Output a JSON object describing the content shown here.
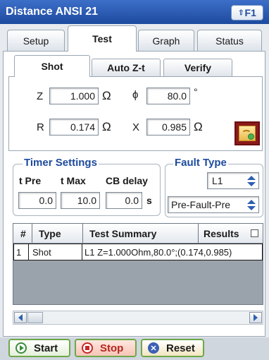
{
  "window": {
    "title": "Distance ANSI 21",
    "help_label": "F1"
  },
  "tabs": [
    {
      "label": "Setup"
    },
    {
      "label": "Test"
    },
    {
      "label": "Graph"
    },
    {
      "label": "Status"
    }
  ],
  "subtabs": [
    {
      "label": "Shot"
    },
    {
      "label": "Auto Z-t"
    },
    {
      "label": "Verify"
    }
  ],
  "shot": {
    "z_label": "Z",
    "z_value": "1.000",
    "z_unit": "Ω",
    "phi_label": "ϕ",
    "phi_value": "80.0",
    "phi_unit": "°",
    "r_label": "R",
    "r_value": "0.174",
    "r_unit": "Ω",
    "x_label": "X",
    "x_value": "0.985",
    "x_unit": "Ω"
  },
  "timer": {
    "title": "Timer Settings",
    "t_pre_label": "t Pre",
    "t_pre_value": "0.0",
    "t_max_label": "t Max",
    "t_max_value": "10.0",
    "cb_delay_label": "CB delay",
    "cb_delay_value": "0.0",
    "unit": "s"
  },
  "fault": {
    "title": "Fault Type",
    "type_value": "L1",
    "mode_value": "Pre-Fault-Pre"
  },
  "table": {
    "columns": [
      "#",
      "Type",
      "Test Summary",
      "Results"
    ],
    "rows": [
      {
        "num": "1",
        "type": "Shot",
        "summary": "L1 Z=1.000Ohm,80.0°;(0.174,0.985)"
      }
    ]
  },
  "buttons": {
    "start": "Start",
    "stop": "Stop",
    "reset": "Reset"
  },
  "colors": {
    "title_bar": "#1d4a9e",
    "accent": "#1d4a9e",
    "start_icon": "#3a8b3a",
    "stop_icon": "#c62828",
    "reset_icon": "#3b5fb5"
  },
  "icons": [
    "help-icon",
    "impedance-picker-icon",
    "spin-up-icon",
    "spin-down-icon",
    "scroll-left-icon",
    "scroll-right-icon",
    "start-icon",
    "stop-icon",
    "reset-icon"
  ]
}
